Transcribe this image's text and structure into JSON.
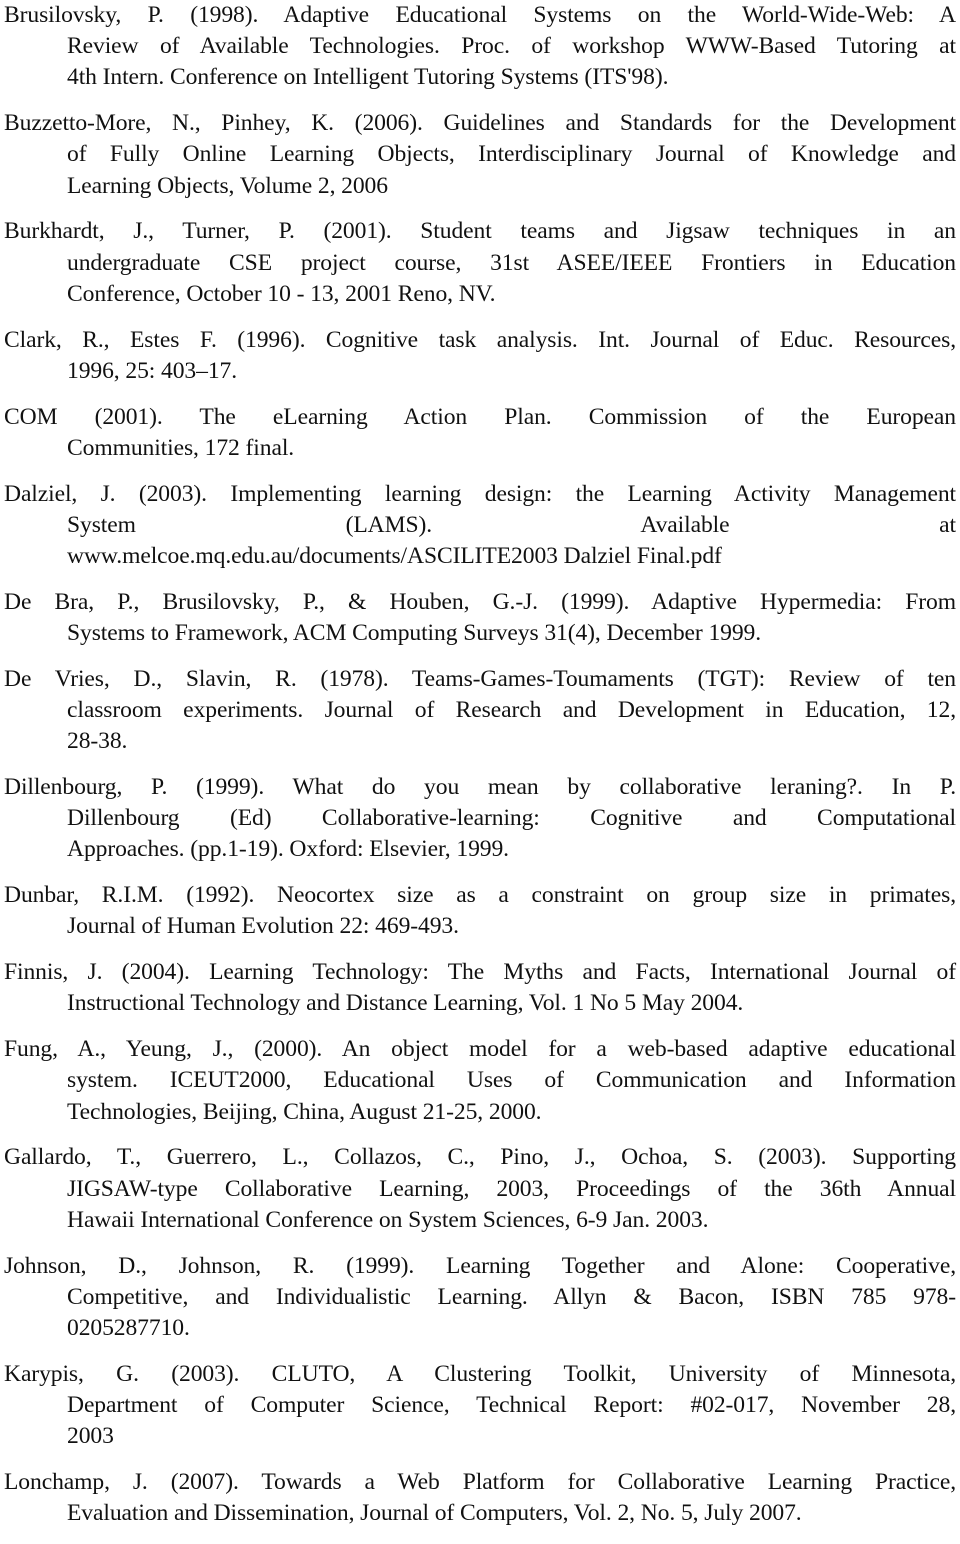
{
  "references": [
    {
      "lines": [
        "Brusilovsky, P. (1998). Adaptive Educational Systems on the World-Wide-Web: A",
        "Review of Available Technologies. Proc. of workshop WWW-Based Tutoring at",
        "4th Intern. Conference on Intelligent Tutoring Systems (ITS'98)."
      ]
    },
    {
      "lines": [
        "Buzzetto-More, N., Pinhey, K. (2006). Guidelines and Standards for the Development",
        "of Fully Online Learning Objects, Interdisciplinary Journal of Knowledge and",
        "Learning Objects, Volume 2, 2006"
      ]
    },
    {
      "lines": [
        "Burkhardt, J., Turner, P. (2001). Student teams and Jigsaw techniques in an",
        "undergraduate CSE project course, 31st ASEE/IEEE Frontiers in Education",
        "Conference, October 10 - 13, 2001 Reno, NV."
      ]
    },
    {
      "lines": [
        "Clark, R., Estes F. (1996). Cognitive task analysis. Int. Journal of Educ. Resources,",
        "1996, 25: 403–17."
      ]
    },
    {
      "lines": [
        "COM (2001). The eLearning Action Plan. Commission of the European",
        "Communities, 172 final."
      ]
    },
    {
      "lines": [
        "Dalziel, J. (2003). Implementing learning design: the Learning Activity Management",
        "System (LAMS). Available at",
        "www.melcoe.mq.edu.au/documents/ASCILITE2003 Dalziel Final.pdf"
      ]
    },
    {
      "lines": [
        "De Bra, P., Brusilovsky, P., & Houben, G.-J. (1999). Adaptive Hypermedia: From",
        "Systems to Framework, ACM Computing Surveys 31(4), December 1999."
      ]
    },
    {
      "lines": [
        "De Vries, D., Slavin, R. (1978). Teams-Games-Toumaments (TGT): Review of ten",
        "classroom experiments. Journal of Research and Development in Education, 12,",
        "28-38."
      ]
    },
    {
      "lines": [
        "Dillenbourg, P. (1999). What do you mean by collaborative leraning?. In P.",
        "Dillenbourg (Ed) Collaborative-learning: Cognitive and Computational",
        "Approaches. (pp.1-19). Oxford: Elsevier, 1999."
      ]
    },
    {
      "lines": [
        "Dunbar, R.I.M. (1992). Neocortex size as a constraint on group size in primates,",
        "Journal of Human Evolution 22: 469-493."
      ]
    },
    {
      "lines": [
        "Finnis, J. (2004). Learning Technology: The Myths and Facts, International Journal of",
        "Instructional Technology and Distance Learning, Vol. 1 No 5 May 2004."
      ]
    },
    {
      "lines": [
        "Fung, A., Yeung, J., (2000). An object model for a web-based adaptive educational",
        "system. ICEUT2000, Educational Uses of Communication and Information",
        "Technologies, Beijing, China, August 21-25, 2000."
      ]
    },
    {
      "lines": [
        "Gallardo, T., Guerrero, L., Collazos, C., Pino, J., Ochoa, S. (2003). Supporting",
        "JIGSAW-type Collaborative Learning, 2003, Proceedings of the 36th Annual",
        "Hawaii International Conference on System Sciences, 6-9 Jan. 2003."
      ]
    },
    {
      "lines": [
        "Johnson, D., Johnson, R. (1999). Learning Together and Alone: Cooperative,",
        "Competitive, and Individualistic  Learning. Allyn & Bacon, ISBN 785 978-",
        "0205287710."
      ]
    },
    {
      "lines": [
        "Karypis, G. (2003). CLUTO, A Clustering Toolkit, University of Minnesota,",
        "Department of Computer Science, Technical Report: #02-017, November 28,",
        "2003"
      ]
    },
    {
      "lines": [
        "Lonchamp, J. (2007). Towards a Web Platform for Collaborative Learning Practice,",
        "Evaluation and Dissemination, Journal of Computers, Vol. 2, No. 5, July 2007."
      ]
    }
  ]
}
